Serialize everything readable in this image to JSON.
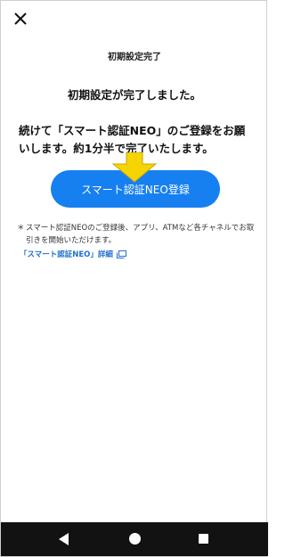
{
  "header": {
    "close_icon": "close-icon",
    "title": "初期設定完了"
  },
  "main": {
    "complete_message": "初期設定が完了しました。",
    "request_message": "続けて「スマート認証NEO」のご登録をお願いします。約1分半で完了いたします。",
    "arrow_color": "#f5d400",
    "register_button": {
      "label": "スマート認証NEO登録",
      "color": "#1780f0"
    },
    "note": {
      "mark": "＊",
      "text": "スマート認証NEOのご登録後、アプリ、ATMなど各チャネルでお取引きを開始いただけます。"
    },
    "detail_link": {
      "label": "「スマート認証NEO」詳細",
      "icon": "external-window-icon"
    }
  },
  "navbar": {
    "back_icon": "back-triangle-icon",
    "home_icon": "home-circle-icon",
    "recents_icon": "recents-square-icon"
  }
}
